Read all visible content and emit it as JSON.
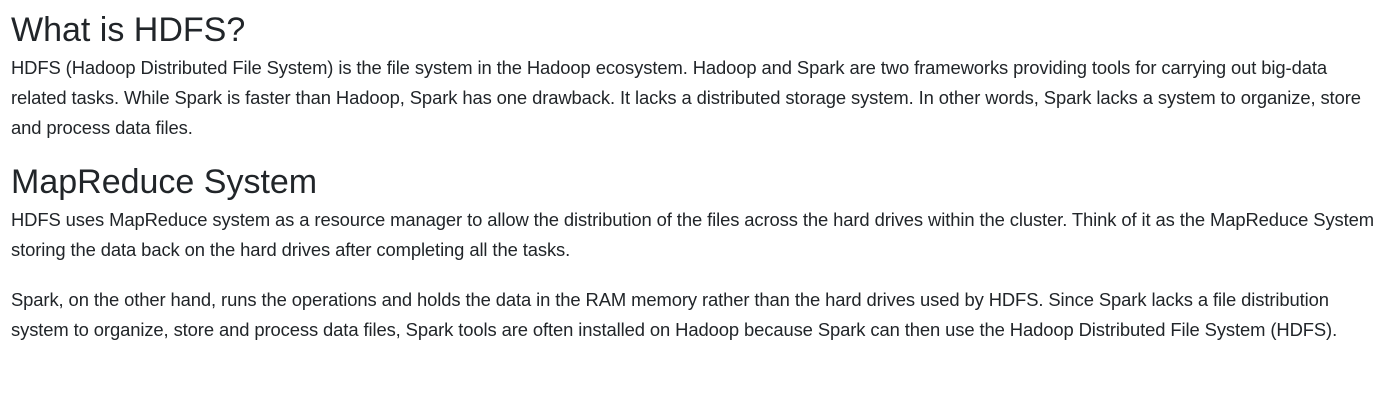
{
  "sections": [
    {
      "heading": "What is HDFS?",
      "paragraphs": [
        "HDFS (Hadoop Distributed File System) is the file system in the Hadoop ecosystem. Hadoop and Spark are two frameworks providing tools for carrying out big-data related tasks. While Spark is faster than Hadoop, Spark has one drawback. It lacks a distributed storage system. In other words, Spark lacks a system to organize, store and process data files."
      ]
    },
    {
      "heading": "MapReduce System",
      "paragraphs": [
        "HDFS uses MapReduce system as a resource manager to allow the distribution of the files across the hard drives within the cluster. Think of it as the MapReduce System storing the data back on the hard drives after completing all the tasks.",
        "Spark, on the other hand, runs the operations and holds the data in the RAM memory rather than the hard drives used by HDFS. Since Spark lacks a file distribution system to organize, store and process data files, Spark tools are often installed on Hadoop because Spark can then use the Hadoop Distributed File System (HDFS)."
      ]
    }
  ]
}
